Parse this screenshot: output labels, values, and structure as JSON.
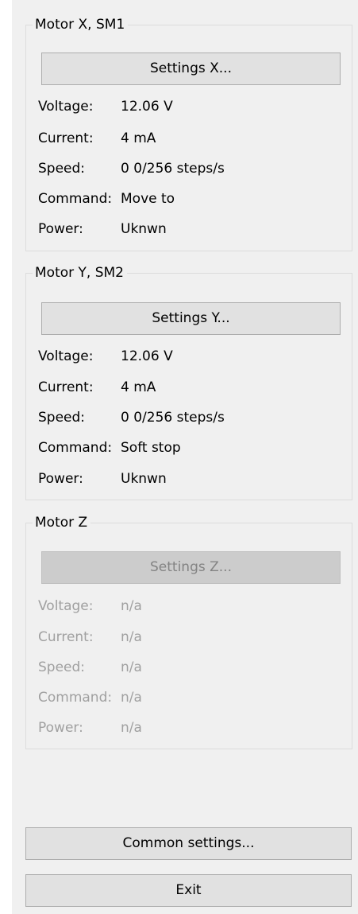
{
  "motor_x": {
    "title": "Motor X, SM1",
    "settings_label": "Settings X...",
    "rows": [
      {
        "label": "Voltage:",
        "value": "12.06 V"
      },
      {
        "label": "Current:",
        "value": "4 mA"
      },
      {
        "label": "Speed:",
        "value": "0 0/256 steps/s"
      },
      {
        "label": "Command:",
        "value": "Move to"
      },
      {
        "label": "Power:",
        "value": "Uknwn"
      }
    ]
  },
  "motor_y": {
    "title": "Motor Y, SM2",
    "settings_label": "Settings Y...",
    "rows": [
      {
        "label": "Voltage:",
        "value": "12.06 V"
      },
      {
        "label": "Current:",
        "value": "4 mA"
      },
      {
        "label": "Speed:",
        "value": "0 0/256 steps/s"
      },
      {
        "label": "Command:",
        "value": "Soft stop"
      },
      {
        "label": "Power:",
        "value": "Uknwn"
      }
    ]
  },
  "motor_z": {
    "title": "Motor Z",
    "settings_label": "Settings Z...",
    "enabled": false,
    "rows": [
      {
        "label": "Voltage:",
        "value": "n/a"
      },
      {
        "label": "Current:",
        "value": "n/a"
      },
      {
        "label": "Speed:",
        "value": "n/a"
      },
      {
        "label": "Command:",
        "value": "n/a"
      },
      {
        "label": "Power:",
        "value": "n/a"
      }
    ]
  },
  "footer": {
    "common_settings_label": "Common settings...",
    "exit_label": "Exit"
  }
}
